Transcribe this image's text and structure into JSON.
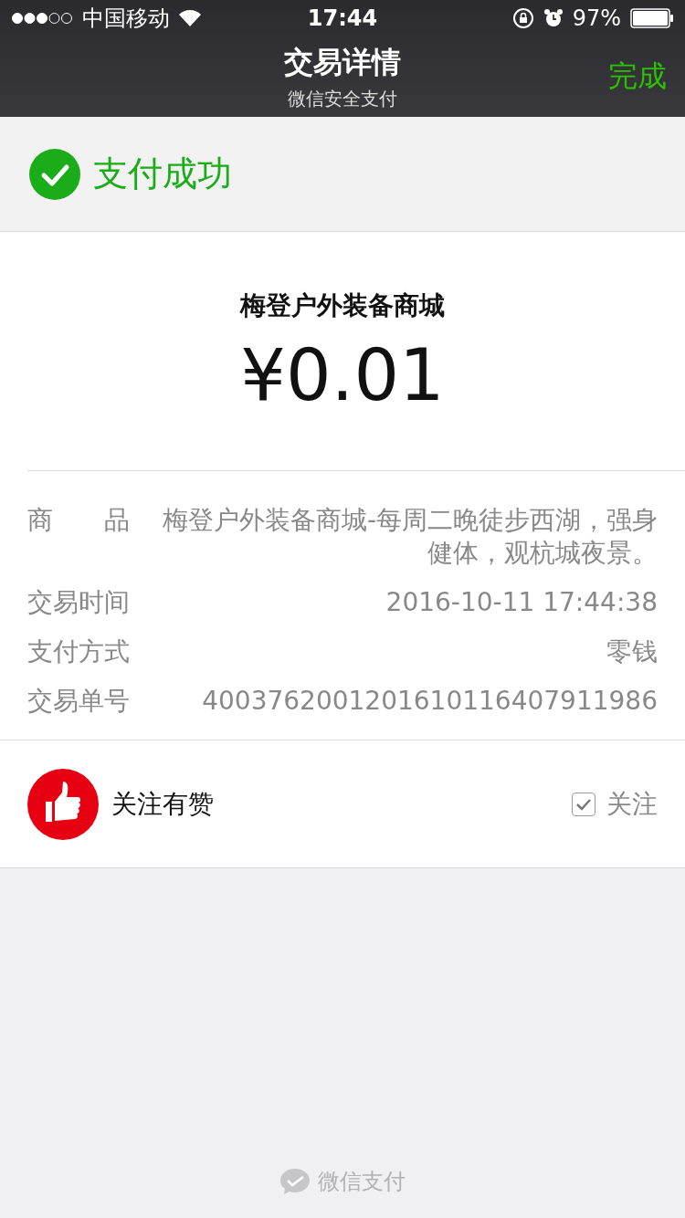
{
  "status_bar": {
    "carrier": "中国移动",
    "time": "17:44",
    "battery": "97%"
  },
  "nav": {
    "title": "交易详情",
    "subtitle": "微信安全支付",
    "action": "完成"
  },
  "result": {
    "text": "支付成功",
    "success": true
  },
  "merchant": "梅登户外装备商城",
  "amount": "¥0.01",
  "details": [
    {
      "label": "商　　品",
      "value": "梅登户外装备商城-每周二晚徒步西湖，强身健体，观杭城夜景。"
    },
    {
      "label": "交易时间",
      "value": "2016-10-11 17:44:38"
    },
    {
      "label": "支付方式",
      "value": "零钱"
    },
    {
      "label": "交易单号",
      "value": "4003762001201610116407911986"
    }
  ],
  "follow": {
    "name": "关注有赞",
    "label": "关注",
    "checked": true
  },
  "footer": "微信支付"
}
